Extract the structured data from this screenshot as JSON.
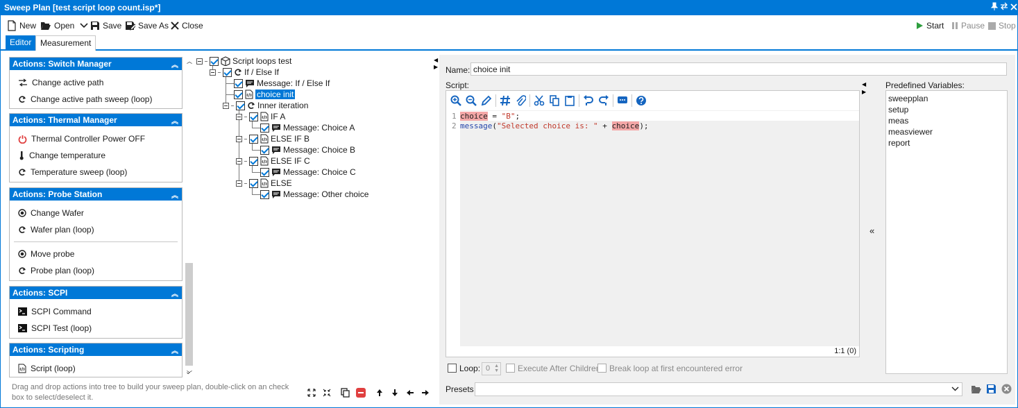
{
  "window": {
    "title": "Sweep Plan [test script loop count.isp*]"
  },
  "toolbar": {
    "new_label": "New",
    "open_label": "Open",
    "save_label": "Save",
    "save_as_label": "Save As",
    "close_label": "Close",
    "start_label": "Start",
    "pause_label": "Pause",
    "stop_label": "Stop"
  },
  "tabs": [
    {
      "label": "Editor"
    },
    {
      "label": "Measurement"
    }
  ],
  "groups": [
    {
      "title": "Actions: Switch Manager",
      "items": [
        "Change active path",
        "Change active path sweep (loop)"
      ]
    },
    {
      "title": "Actions: Thermal Manager",
      "items": [
        "Thermal Controller Power OFF",
        "Change temperature",
        "Temperature sweep (loop)"
      ]
    },
    {
      "title": "Actions: Probe Station",
      "items": [
        "Change Wafer",
        "Wafer plan (loop)",
        "Move probe",
        "Probe plan (loop)"
      ]
    },
    {
      "title": "Actions: SCPI",
      "items": [
        "SCPI Command",
        "SCPI Test (loop)"
      ]
    },
    {
      "title": "Actions: Scripting",
      "items": [
        "Script (loop)"
      ]
    }
  ],
  "hint": "Drag and drop actions into tree to build your sweep plan, double-click on an check box to select/deselect it.",
  "tree": [
    {
      "label": "Script loops test"
    },
    {
      "label": "If / Else If"
    },
    {
      "label": "Message: If / Else If"
    },
    {
      "label": "choice init"
    },
    {
      "label": "Inner iteration"
    },
    {
      "label": "IF A"
    },
    {
      "label": "Message: Choice A"
    },
    {
      "label": "ELSE IF B"
    },
    {
      "label": "Message: Choice B"
    },
    {
      "label": "ELSE IF C"
    },
    {
      "label": "Message: Choice C"
    },
    {
      "label": "ELSE"
    },
    {
      "label": "Message: Other choice"
    }
  ],
  "editor": {
    "name_label": "Name:",
    "name_value": "choice init",
    "script_label": "Script:",
    "line_numbers": [
      "1",
      "2"
    ],
    "code": {
      "l1_var": "choice",
      "l1_op": " = ",
      "l1_str": "\"B\"",
      "l1_end": ";",
      "l2_fn": "message",
      "l2_open": "(",
      "l2_str": "\"Selected choice is: \"",
      "l2_plus": " + ",
      "l2_var": "choice",
      "l2_end": ");"
    },
    "cursor_position": "1:1 (0)",
    "loop_label": "Loop:",
    "loop_value": "0",
    "execute_after_children": "Execute After Children",
    "break_loop": "Break loop at first encountered error",
    "presets_label": "Presets",
    "predefined_label": "Predefined Variables:",
    "variables": [
      "sweepplan",
      "setup",
      "meas",
      "measviewer",
      "report"
    ],
    "collapse_glyph": "«"
  },
  "colors": {
    "accent": "#0078d7",
    "highlight": "#f4a7a7",
    "stop": "#e04040"
  }
}
